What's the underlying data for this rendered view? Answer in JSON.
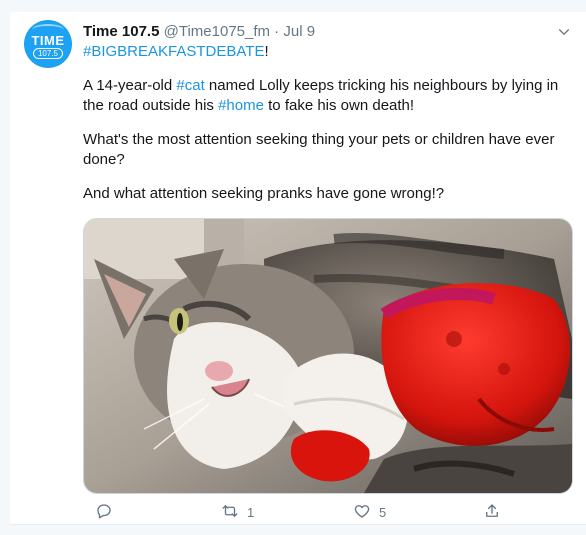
{
  "tweet": {
    "avatar": {
      "main_text": "TIME",
      "sub_text": "107.5"
    },
    "author_name": "Time 107.5",
    "handle": "@Time1075_fm",
    "separator": " · ",
    "date": "Jul 9",
    "hashtag_line": {
      "tag": "#BIGBREAKFASTDEBATE",
      "suffix": "!"
    },
    "para1": {
      "part1": "A 14-year-old ",
      "link1": "#cat",
      "part2": " named Lolly keeps tricking his neighbours by lying in the road outside his ",
      "link2": "#home",
      "part3": " to fake his own death!"
    },
    "para2": "What's the most attention seeking thing your pets or children have ever done?",
    "para3": "And what attention seeking pranks have gone wrong!?",
    "image_alt": "Tabby and white cat lying on its side hugging a red plush toy",
    "actions": {
      "reply_count": "",
      "retweet_count": "1",
      "like_count": "5"
    },
    "icons": [
      "chevron-down-icon",
      "reply-icon",
      "retweet-icon",
      "like-icon",
      "share-icon"
    ],
    "colors": {
      "link": "#1b95e0",
      "avatar_bg": "#1da1f2",
      "muted": "#657786"
    }
  }
}
